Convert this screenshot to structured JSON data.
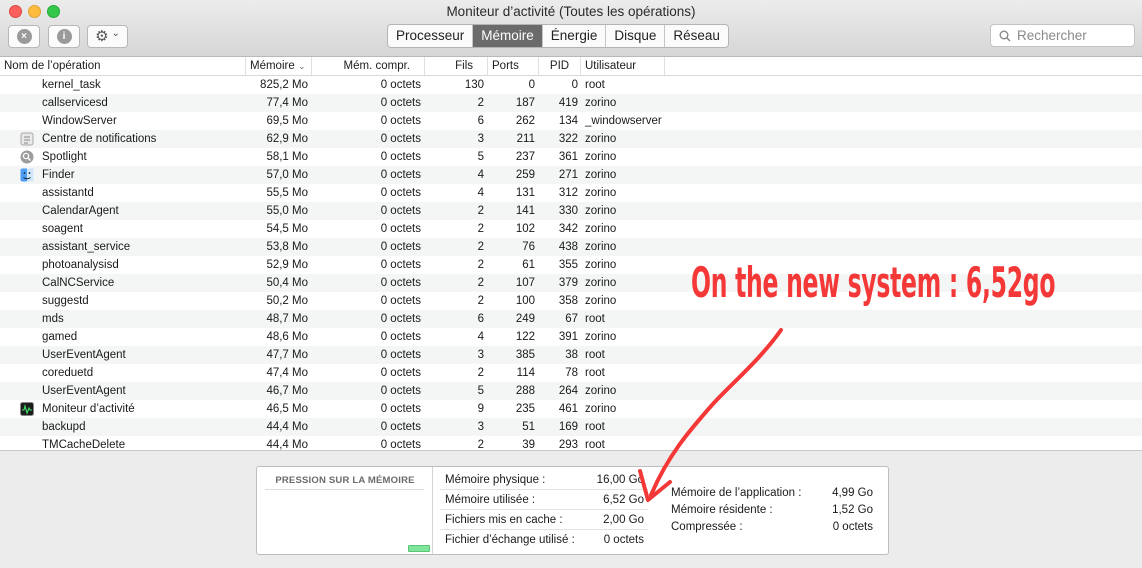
{
  "window": {
    "title": "Moniteur d’activité (Toutes les opérations)"
  },
  "toolbar": {
    "tabs": [
      "Processeur",
      "Mémoire",
      "Énergie",
      "Disque",
      "Réseau"
    ],
    "active_tab": "Mémoire",
    "search_placeholder": "Rechercher",
    "stop_icon": "×",
    "info_icon": "i",
    "gear_icon": "⚙",
    "chevron_icon": "⌄"
  },
  "table": {
    "columns": {
      "name": "Nom de l’opération",
      "memory": "Mémoire",
      "compressed": "Mém. compr.",
      "threads": "Fils",
      "ports": "Ports",
      "pid": "PID",
      "user": "Utilisateur"
    },
    "sort_indicator": "⌄",
    "rows": [
      {
        "name": "kernel_task",
        "mem": "825,2 Mo",
        "comp": "0 octets",
        "fils": "130",
        "ports": "0",
        "pid": "0",
        "user": "root",
        "icon": ""
      },
      {
        "name": "callservicesd",
        "mem": "77,4 Mo",
        "comp": "0 octets",
        "fils": "2",
        "ports": "187",
        "pid": "419",
        "user": "zorino",
        "icon": ""
      },
      {
        "name": "WindowServer",
        "mem": "69,5 Mo",
        "comp": "0 octets",
        "fils": "6",
        "ports": "262",
        "pid": "134",
        "user": "_windowserver",
        "icon": ""
      },
      {
        "name": "Centre de notifications",
        "mem": "62,9 Mo",
        "comp": "0 octets",
        "fils": "3",
        "ports": "211",
        "pid": "322",
        "user": "zorino",
        "icon": "notifications-icon"
      },
      {
        "name": "Spotlight",
        "mem": "58,1 Mo",
        "comp": "0 octets",
        "fils": "5",
        "ports": "237",
        "pid": "361",
        "user": "zorino",
        "icon": "spotlight-icon"
      },
      {
        "name": "Finder",
        "mem": "57,0 Mo",
        "comp": "0 octets",
        "fils": "4",
        "ports": "259",
        "pid": "271",
        "user": "zorino",
        "icon": "finder-icon"
      },
      {
        "name": "assistantd",
        "mem": "55,5 Mo",
        "comp": "0 octets",
        "fils": "4",
        "ports": "131",
        "pid": "312",
        "user": "zorino",
        "icon": ""
      },
      {
        "name": "CalendarAgent",
        "mem": "55,0 Mo",
        "comp": "0 octets",
        "fils": "2",
        "ports": "141",
        "pid": "330",
        "user": "zorino",
        "icon": ""
      },
      {
        "name": "soagent",
        "mem": "54,5 Mo",
        "comp": "0 octets",
        "fils": "2",
        "ports": "102",
        "pid": "342",
        "user": "zorino",
        "icon": ""
      },
      {
        "name": "assistant_service",
        "mem": "53,8 Mo",
        "comp": "0 octets",
        "fils": "2",
        "ports": "76",
        "pid": "438",
        "user": "zorino",
        "icon": ""
      },
      {
        "name": "photoanalysisd",
        "mem": "52,9 Mo",
        "comp": "0 octets",
        "fils": "2",
        "ports": "61",
        "pid": "355",
        "user": "zorino",
        "icon": ""
      },
      {
        "name": "CalNCService",
        "mem": "50,4 Mo",
        "comp": "0 octets",
        "fils": "2",
        "ports": "107",
        "pid": "379",
        "user": "zorino",
        "icon": ""
      },
      {
        "name": "suggestd",
        "mem": "50,2 Mo",
        "comp": "0 octets",
        "fils": "2",
        "ports": "100",
        "pid": "358",
        "user": "zorino",
        "icon": ""
      },
      {
        "name": "mds",
        "mem": "48,7 Mo",
        "comp": "0 octets",
        "fils": "6",
        "ports": "249",
        "pid": "67",
        "user": "root",
        "icon": ""
      },
      {
        "name": "gamed",
        "mem": "48,6 Mo",
        "comp": "0 octets",
        "fils": "4",
        "ports": "122",
        "pid": "391",
        "user": "zorino",
        "icon": ""
      },
      {
        "name": "UserEventAgent",
        "mem": "47,7 Mo",
        "comp": "0 octets",
        "fils": "3",
        "ports": "385",
        "pid": "38",
        "user": "root",
        "icon": ""
      },
      {
        "name": "coreduetd",
        "mem": "47,4 Mo",
        "comp": "0 octets",
        "fils": "2",
        "ports": "114",
        "pid": "78",
        "user": "root",
        "icon": ""
      },
      {
        "name": "UserEventAgent",
        "mem": "46,7 Mo",
        "comp": "0 octets",
        "fils": "5",
        "ports": "288",
        "pid": "264",
        "user": "zorino",
        "icon": ""
      },
      {
        "name": "Moniteur d’activité",
        "mem": "46,5 Mo",
        "comp": "0 octets",
        "fils": "9",
        "ports": "235",
        "pid": "461",
        "user": "zorino",
        "icon": "activity-monitor-icon"
      },
      {
        "name": "backupd",
        "mem": "44,4 Mo",
        "comp": "0 octets",
        "fils": "3",
        "ports": "51",
        "pid": "169",
        "user": "root",
        "icon": ""
      },
      {
        "name": "TMCacheDelete",
        "mem": "44,4 Mo",
        "comp": "0 octets",
        "fils": "2",
        "ports": "39",
        "pid": "293",
        "user": "root",
        "icon": ""
      }
    ]
  },
  "memory_summary": {
    "pressure_title": "PRESSION SUR LA MÉMOIRE",
    "pressure_level": 0.03,
    "pressure_color": "#7fe59a",
    "left_stats": [
      {
        "label": "Mémoire physique :",
        "value": "16,00 Go"
      },
      {
        "label": "Mémoire utilisée :",
        "value": "6,52 Go"
      },
      {
        "label": "Fichiers mis en cache :",
        "value": "2,00 Go"
      },
      {
        "label": "Fichier d’échange utilisé :",
        "value": "0 octets"
      }
    ],
    "right_stats": [
      {
        "label": "Mémoire de l’application :",
        "value": "4,99 Go"
      },
      {
        "label": "Mémoire résidente :",
        "value": "1,52 Go"
      },
      {
        "label": "Compressée :",
        "value": "0 octets"
      }
    ]
  },
  "annotation": {
    "text": "On the new system : 6,52go",
    "color": "#f43737"
  }
}
